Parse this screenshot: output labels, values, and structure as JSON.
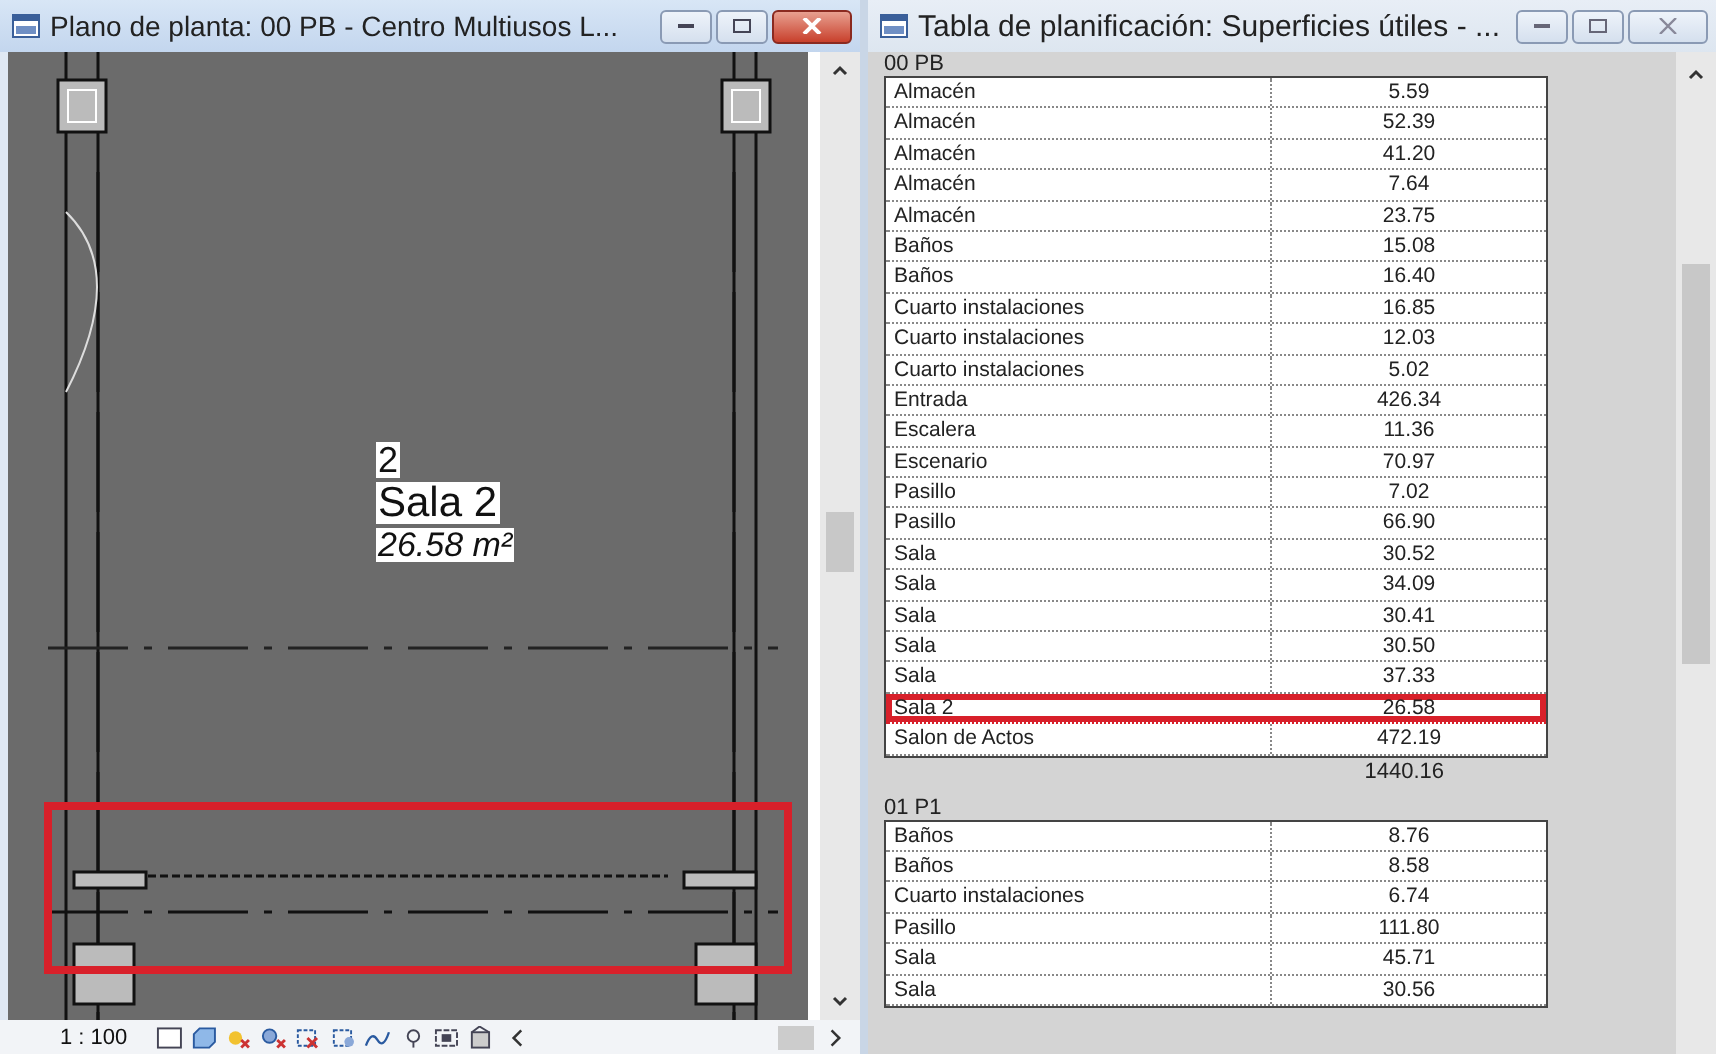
{
  "plan_window": {
    "title": "Plano de planta: 00 PB - Centro Multiusos L...",
    "active": true,
    "room_tag": {
      "number": "2",
      "name": "Sala 2",
      "area": "26.58 m²"
    },
    "highlight": true,
    "scale": "1 : 100"
  },
  "schedule_window": {
    "title": "Tabla de planificación: Superficies útiles - ...",
    "active": false,
    "groups": [
      {
        "header": "00 PB",
        "total": "1440.16",
        "rows": [
          {
            "name": "Almacén",
            "area": "5.59",
            "highlighted": false
          },
          {
            "name": "Almacén",
            "area": "52.39",
            "highlighted": false
          },
          {
            "name": "Almacén",
            "area": "41.20",
            "highlighted": false
          },
          {
            "name": "Almacén",
            "area": "7.64",
            "highlighted": false
          },
          {
            "name": "Almacén",
            "area": "23.75",
            "highlighted": false
          },
          {
            "name": "Baños",
            "area": "15.08",
            "highlighted": false
          },
          {
            "name": "Baños",
            "area": "16.40",
            "highlighted": false
          },
          {
            "name": "Cuarto instalaciones",
            "area": "16.85",
            "highlighted": false
          },
          {
            "name": "Cuarto instalaciones",
            "area": "12.03",
            "highlighted": false
          },
          {
            "name": "Cuarto instalaciones",
            "area": "5.02",
            "highlighted": false
          },
          {
            "name": "Entrada",
            "area": "426.34",
            "highlighted": false
          },
          {
            "name": "Escalera",
            "area": "11.36",
            "highlighted": false
          },
          {
            "name": "Escenario",
            "area": "70.97",
            "highlighted": false
          },
          {
            "name": "Pasillo",
            "area": "7.02",
            "highlighted": false
          },
          {
            "name": "Pasillo",
            "area": "66.90",
            "highlighted": false
          },
          {
            "name": "Sala",
            "area": "30.52",
            "highlighted": false
          },
          {
            "name": "Sala",
            "area": "34.09",
            "highlighted": false
          },
          {
            "name": "Sala",
            "area": "30.41",
            "highlighted": false
          },
          {
            "name": "Sala",
            "area": "30.50",
            "highlighted": false
          },
          {
            "name": "Sala",
            "area": "37.33",
            "highlighted": false
          },
          {
            "name": "Sala 2",
            "area": "26.58",
            "highlighted": true
          },
          {
            "name": "Salon de Actos",
            "area": "472.19",
            "highlighted": false
          }
        ]
      },
      {
        "header": "01 P1",
        "rows": [
          {
            "name": "Baños",
            "area": "8.76",
            "highlighted": false
          },
          {
            "name": "Baños",
            "area": "8.58",
            "highlighted": false
          },
          {
            "name": "Cuarto instalaciones",
            "area": "6.74",
            "highlighted": false
          },
          {
            "name": "Pasillo",
            "area": "111.80",
            "highlighted": false
          },
          {
            "name": "Sala",
            "area": "45.71",
            "highlighted": false
          },
          {
            "name": "Sala",
            "area": "30.56",
            "highlighted": false
          }
        ]
      }
    ]
  }
}
